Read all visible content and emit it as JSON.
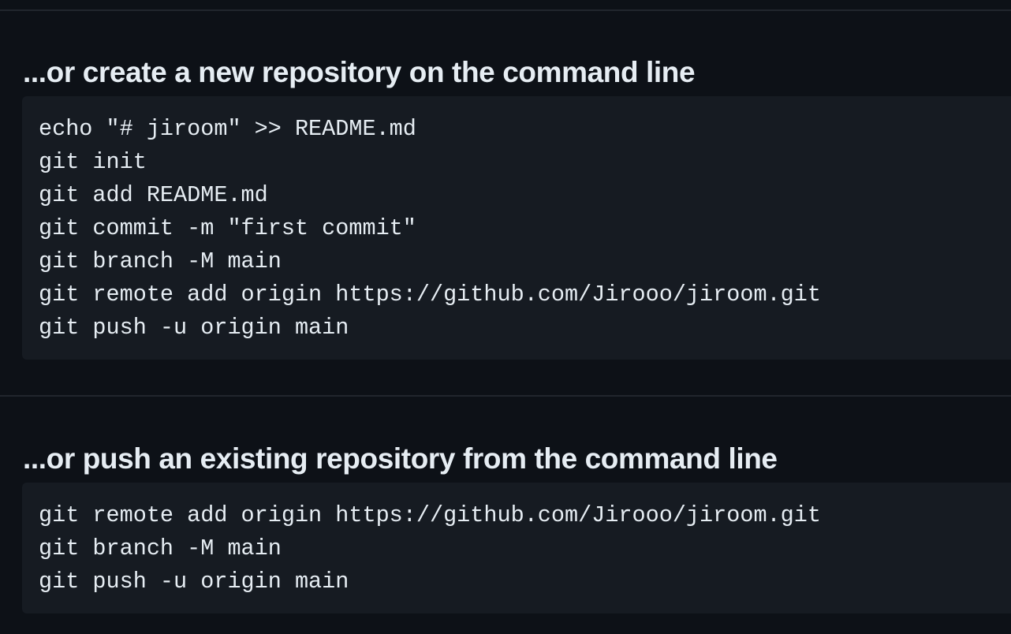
{
  "sections": [
    {
      "title": "...or create a new repository on the command line",
      "lines": [
        "echo \"# jiroom\" >> README.md",
        "git init",
        "git add README.md",
        "git commit -m \"first commit\"",
        "git branch -M main",
        "git remote add origin https://github.com/Jirooo/jiroom.git",
        "git push -u origin main"
      ]
    },
    {
      "title": "...or push an existing repository from the command line",
      "lines": [
        "git remote add origin https://github.com/Jirooo/jiroom.git",
        "git branch -M main",
        "git push -u origin main"
      ]
    }
  ],
  "colors": {
    "background": "#0d1117",
    "code_background": "#161b22",
    "divider": "#21262d",
    "text": "#e6edf3"
  }
}
